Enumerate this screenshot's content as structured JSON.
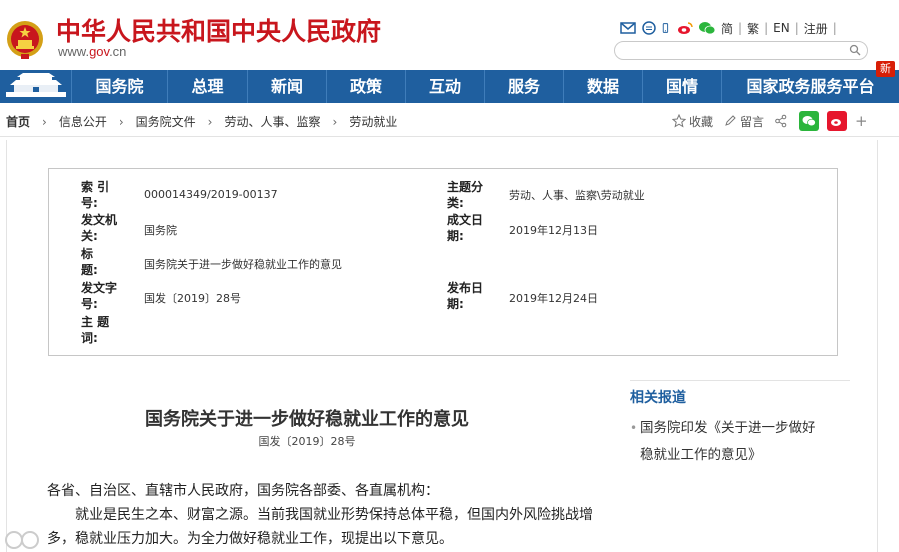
{
  "header": {
    "site_title": "中华人民共和国中央人民政府",
    "domain_prefix": "www.",
    "domain_main": "gov",
    "domain_suffix": ".cn",
    "toplinks": {
      "simplified": "简",
      "traditional": "繁",
      "english": "EN",
      "register": "注册"
    },
    "search_placeholder": ""
  },
  "nav": {
    "items": [
      "国务院",
      "总理",
      "新闻",
      "政策",
      "互动",
      "服务",
      "数据",
      "国情",
      "国家政务服务平台"
    ],
    "new_badge": "新"
  },
  "breadcrumb": {
    "items": [
      "首页",
      "信息公开",
      "国务院文件",
      "劳动、人事、监察",
      "劳动就业"
    ]
  },
  "tools": {
    "favorite": "收藏",
    "comment": "留言",
    "plus": "+"
  },
  "info_table": {
    "index_label": "索 引 号:",
    "index_value": "000014349/2019-00137",
    "topic_category_label": "主题分类:",
    "topic_category_value": "劳动、人事、监察\\劳动就业",
    "issuer_label": "发文机关:",
    "issuer_value": "国务院",
    "written_date_label": "成文日期:",
    "written_date_value": "2019年12月13日",
    "title_label": "标 题:",
    "title_value": "国务院关于进一步做好稳就业工作的意见",
    "doc_no_label": "发文字号:",
    "doc_no_value": "国发〔2019〕28号",
    "publish_date_label": "发布日期:",
    "publish_date_value": "2019年12月24日",
    "subject_words_label": "主 题 词:",
    "subject_words_value": ""
  },
  "article": {
    "title": "国务院关于进一步做好稳就业工作的意见",
    "doc_number": "国发〔2019〕28号",
    "salutation": "各省、自治区、直辖市人民政府，国务院各部委、各直属机构：",
    "para1_line1": "就业是民生之本、财富之源。当前我国就业形势保持总体平稳，但国内外风险挑战增",
    "para1_line2": "多，稳就业压力加大。为全力做好稳就业工作，现提出以下意见。"
  },
  "related": {
    "title": "相关报道",
    "items": [
      "国务院印发《关于进一步做好稳就业工作的意见》"
    ],
    "item_line1": "国务院印发《关于进一步做好",
    "item_line2": "稳就业工作的意见》"
  },
  "colors": {
    "brand_red": "#c8161d",
    "nav_blue": "#1f5f9f",
    "wechat_green": "#2bb53c",
    "weibo_red": "#e6162d"
  }
}
